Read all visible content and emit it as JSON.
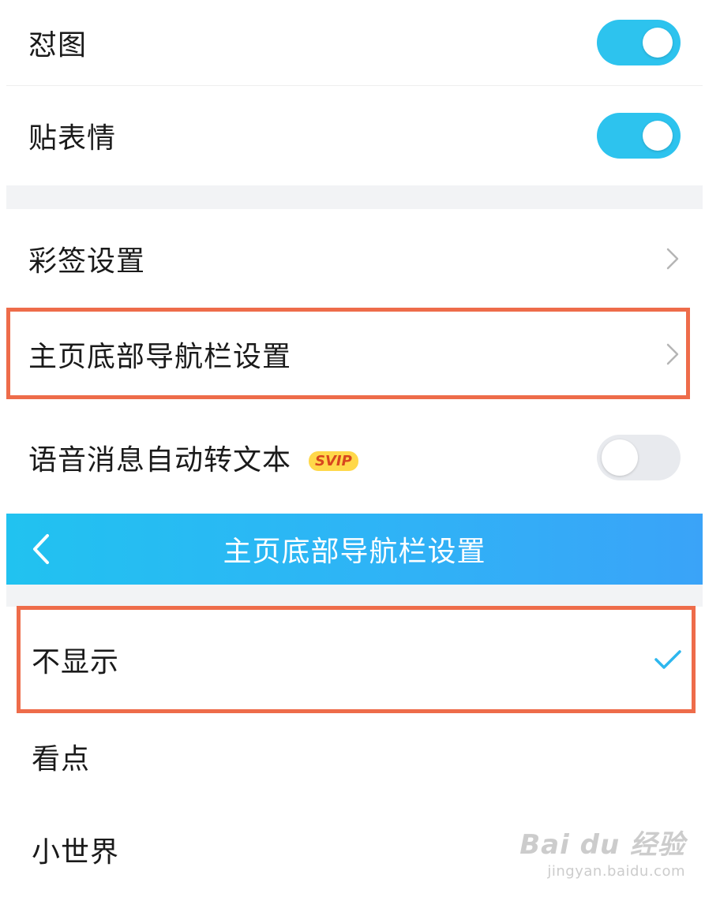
{
  "settings": {
    "items": [
      {
        "label": "怼图",
        "control": "toggle",
        "on": true
      },
      {
        "label": "贴表情",
        "control": "toggle",
        "on": true
      },
      {
        "label": "彩签设置",
        "control": "chevron"
      },
      {
        "label": "主页底部导航栏设置",
        "control": "chevron"
      },
      {
        "label": "语音消息自动转文本",
        "badge": "SVIP",
        "control": "toggle",
        "on": false
      }
    ]
  },
  "navbar": {
    "title": "主页底部导航栏设置",
    "back_icon": "chevron-left-icon"
  },
  "options": [
    {
      "label": "不显示",
      "selected": true
    },
    {
      "label": "看点",
      "selected": false
    },
    {
      "label": "小世界",
      "selected": false
    }
  ],
  "watermark": {
    "logo": "Bai du 经验",
    "url": "jingyan.baidu.com"
  },
  "colors": {
    "toggle_on": "#2dc3ee",
    "toggle_off": "#e8eaee",
    "navbar_gradient_start": "#21c2f0",
    "navbar_gradient_end": "#3aa3f8",
    "highlight_border": "#ee6c4a",
    "check_mark": "#2db7ee",
    "svip_badge": "#ffd84a"
  }
}
